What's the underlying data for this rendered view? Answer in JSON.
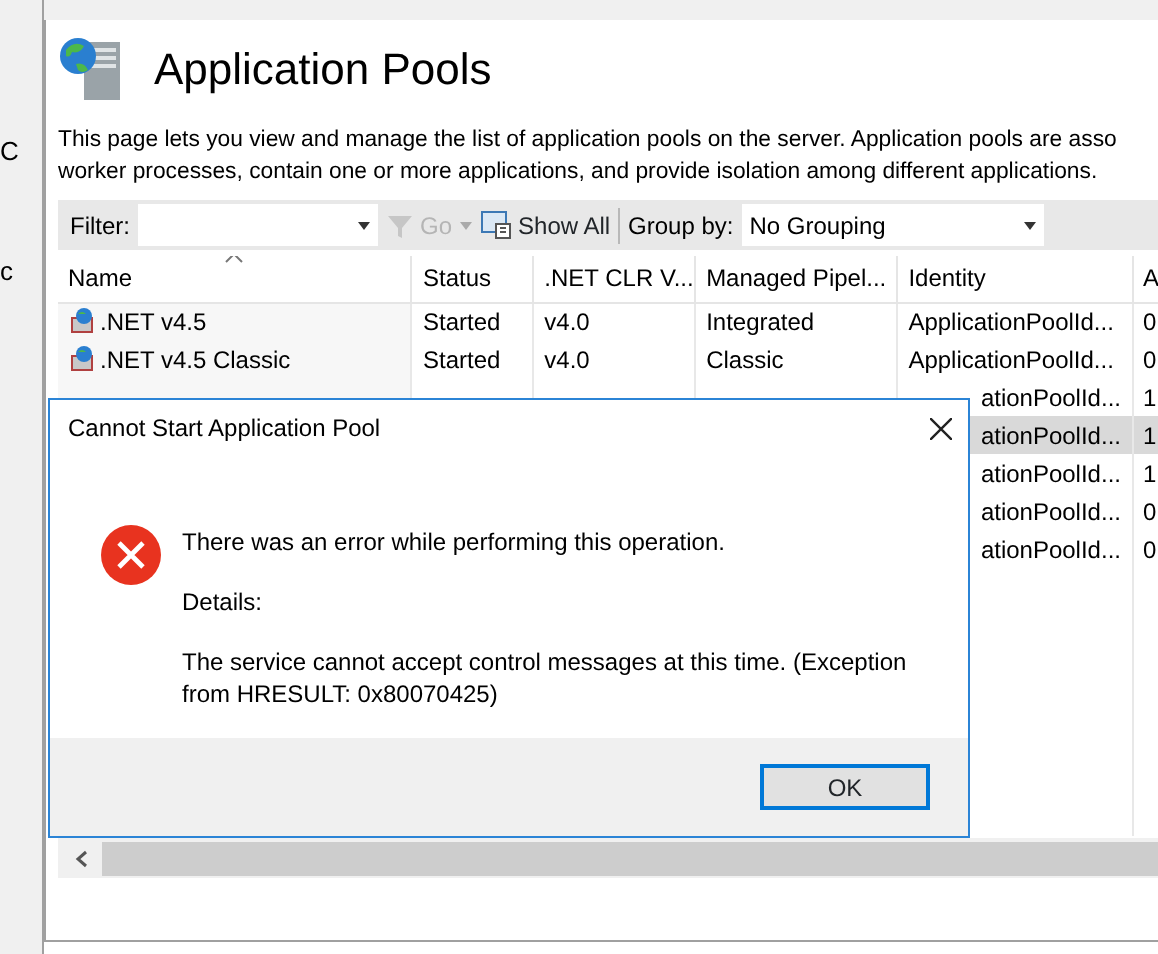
{
  "left_panel": {
    "texts": [
      "C",
      "c"
    ]
  },
  "header": {
    "title": "Application Pools",
    "description_lines": [
      "This page lets you view and manage the list of application pools on the server. Application pools are asso",
      "worker processes, contain one or more applications, and provide isolation among different applications."
    ]
  },
  "toolbar": {
    "filter_label": "Filter:",
    "go_label": "Go",
    "go_disabled": true,
    "show_all_label": "Show All",
    "group_by_label": "Group by:",
    "group_by_value": "No Grouping"
  },
  "table": {
    "columns": [
      {
        "label": "Name",
        "sorted": true
      },
      {
        "label": "Status",
        "sorted": false
      },
      {
        "label": ".NET CLR V...",
        "sorted": false
      },
      {
        "label": "Managed Pipel...",
        "sorted": false
      },
      {
        "label": "Identity",
        "sorted": false
      },
      {
        "label": "A",
        "sorted": false
      }
    ],
    "rows": [
      {
        "cells": [
          ".NET v4.5",
          "Started",
          "v4.0",
          "Integrated",
          "ApplicationPoolId...",
          "0"
        ],
        "selected": false
      },
      {
        "cells": [
          ".NET v4.5 Classic",
          "Started",
          "v4.0",
          "Classic",
          "ApplicationPoolId...",
          "0"
        ],
        "selected": false
      },
      {
        "cells": [
          null,
          null,
          null,
          null,
          "ationPoolId...",
          "1"
        ],
        "selected": false
      },
      {
        "cells": [
          null,
          null,
          null,
          null,
          "ationPoolId...",
          "1"
        ],
        "selected": true
      },
      {
        "cells": [
          null,
          null,
          null,
          null,
          "ationPoolId...",
          "1"
        ],
        "selected": false
      },
      {
        "cells": [
          null,
          null,
          null,
          null,
          "ationPoolId...",
          "0"
        ],
        "selected": false
      },
      {
        "cells": [
          null,
          null,
          null,
          null,
          "ationPoolId...",
          "0"
        ],
        "selected": false
      }
    ]
  },
  "dialog": {
    "title": "Cannot Start Application Pool",
    "message": "There was an error while performing this operation.",
    "details_label": "Details:",
    "details": "The service cannot accept control messages at this time. (Exception from HRESULT: 0x80070425)",
    "button": "OK"
  }
}
